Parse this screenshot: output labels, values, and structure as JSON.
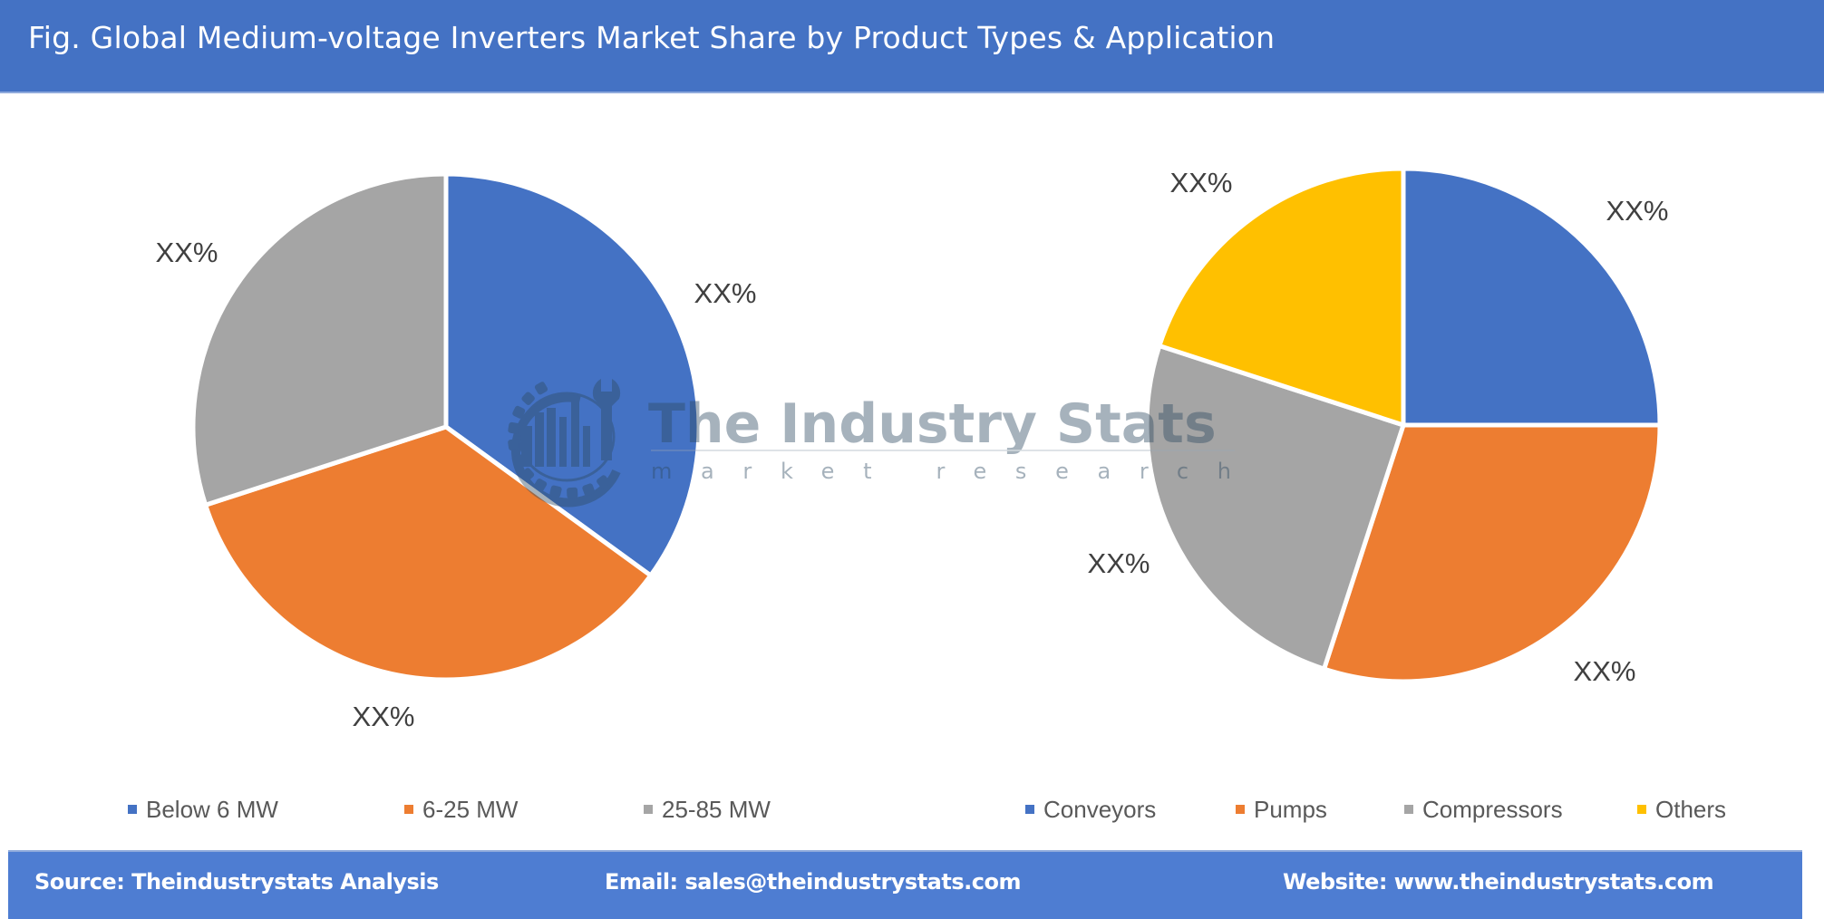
{
  "header": {
    "title": "Fig. Global Medium-voltage Inverters Market Share by Product Types & Application"
  },
  "watermark": {
    "title": "The Industry Stats",
    "subtitle": "market research",
    "icon": "gear-wrench-chart-logo"
  },
  "chart_data": [
    {
      "type": "pie",
      "title": "Product Types",
      "categories": [
        "Below 6 MW",
        "6-25 MW",
        "25-85 MW"
      ],
      "values": [
        35,
        35,
        30
      ],
      "colors": [
        "#4472C4",
        "#ED7D31",
        "#A5A5A5"
      ],
      "data_labels": [
        "XX%",
        "XX%",
        "XX%"
      ],
      "start_angle_deg": 0,
      "direction": "clockwise",
      "legend": "bottom"
    },
    {
      "type": "pie",
      "title": "Application",
      "categories": [
        "Conveyors",
        "Pumps",
        "Compressors",
        "Others"
      ],
      "values": [
        25,
        30,
        25,
        20
      ],
      "colors": [
        "#4472C4",
        "#ED7D31",
        "#A5A5A5",
        "#FFC000"
      ],
      "data_labels": [
        "XX%",
        "XX%",
        "XX%",
        "XX%"
      ],
      "start_angle_deg": 0,
      "direction": "clockwise",
      "legend": "bottom"
    }
  ],
  "footer": {
    "source": "Source: Theindustrystats Analysis",
    "email": "Email: sales@theindustrystats.com",
    "website": "Website: www.theindustrystats.com"
  }
}
